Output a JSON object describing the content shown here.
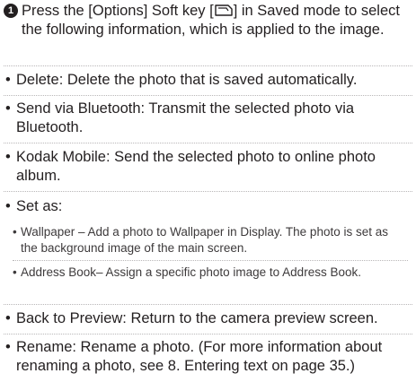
{
  "step": {
    "number": "1",
    "text_before_icon": "Press the [Options] Soft key [",
    "icon": "options-soft-key-icon",
    "text_after_icon": "] in Saved mode to select the following information, which is applied to the image."
  },
  "bullet_glyph": "•",
  "items": [
    {
      "text": "Delete: Delete the photo that is saved automatically."
    },
    {
      "text": "Send via Bluetooth: Transmit the selected photo via Bluetooth."
    },
    {
      "text": "Kodak Mobile: Send the selected photo to online photo album."
    },
    {
      "text": "Set as:"
    },
    {
      "text": "Back to Preview: Return to the camera preview screen."
    },
    {
      "text": "Rename: Rename a photo. (For more information about renaming a photo, see 8. Entering text on page 35.)"
    }
  ],
  "set_as_options": [
    {
      "text": "Wallpaper – Add a photo to Wallpaper in Display. The photo is set as the background image of the main screen."
    },
    {
      "text": "Address Book– Assign a specific photo image to Address Book."
    }
  ]
}
